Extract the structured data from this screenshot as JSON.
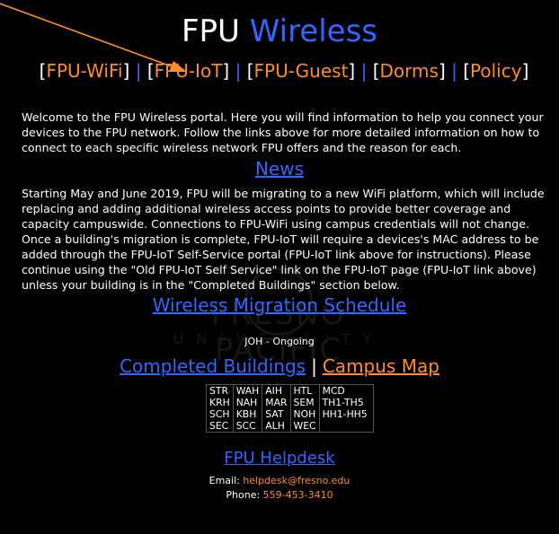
{
  "header": {
    "title_part1": "FPU",
    "title_part2": "Wireless"
  },
  "nav": {
    "items": [
      "FPU-WiFi",
      "FPU-IoT",
      "FPU-Guest",
      "Dorms",
      "Policy"
    ],
    "separator": "|"
  },
  "intro": {
    "text": "Welcome to the FPU Wireless portal. Here you will find information to help you connect your devices to the FPU network. Follow the links above for more detailed information on how to connect to each specific wireless network FPU offers and the reason for each."
  },
  "news": {
    "heading": "News",
    "text": "Starting May and June 2019, FPU will be migrating to a new WiFi platform, which will include replacing and adding additional wireless access points to provide better coverage and capacity campuswide. Connections to FPU-WiFi using campus credentials will not change. Once a building's migration is complete, FPU-IoT will require a devices's MAC address to be added through the FPU-IoT Self-Service portal (FPU-IoT link above for instructions). Please continue using the \"Old FPU-IoT Self Service\" link on the FPU-IoT page (FPU-IoT link above) unless your building is in the \"Completed Buildings\" section below."
  },
  "migration": {
    "heading": "Wireless Migration Schedule",
    "status": "JOH - Ongoing"
  },
  "buildings": {
    "completed_label": "Completed Buildings",
    "separator": "|",
    "map_label": "Campus Map",
    "columns": [
      [
        "STR",
        "KRH",
        "SCH",
        "SEC"
      ],
      [
        "WAH",
        "NAH",
        "KBH",
        "SCC"
      ],
      [
        "AIH",
        "MAR",
        "SAT",
        "ALH"
      ],
      [
        "HTL",
        "SEM",
        "NOH",
        "WEC"
      ],
      [
        "MCD",
        "TH1-TH5",
        "HH1-HH5",
        ""
      ]
    ]
  },
  "helpdesk": {
    "heading": "FPU Helpdesk",
    "email_label": "Email:",
    "email": "helpdesk@fresno.edu",
    "phone_label": "Phone:",
    "phone": "559-453-3410"
  },
  "watermark": {
    "line1": "FRESNO PACIFIC",
    "line2": "UNIVERSITY"
  },
  "colors": {
    "background": "#000000",
    "accent_blue": "#3366ff",
    "accent_orange": "#ff8c2a"
  }
}
